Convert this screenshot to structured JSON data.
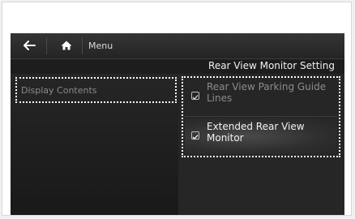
{
  "header": {
    "back_icon": "arrow-left-icon",
    "home_icon": "home-icon",
    "menu_label": "Menu"
  },
  "screen_title": "Rear View Monitor Setting",
  "left_menu": {
    "items": [
      {
        "label": "Display Contents",
        "highlighted": true
      }
    ]
  },
  "options": [
    {
      "label": "Rear View Parking Guide Lines",
      "checked": true,
      "enabled": false
    },
    {
      "label": "Extended Rear View Monitor",
      "checked": true,
      "enabled": true
    }
  ],
  "colors": {
    "screen_bg": "#1d1d1d",
    "topbar_bg": "#2c2c2c",
    "highlight_outline": "#ffffff",
    "active_text": "#f2f2f2",
    "dim_text": "#8a8a8a"
  }
}
